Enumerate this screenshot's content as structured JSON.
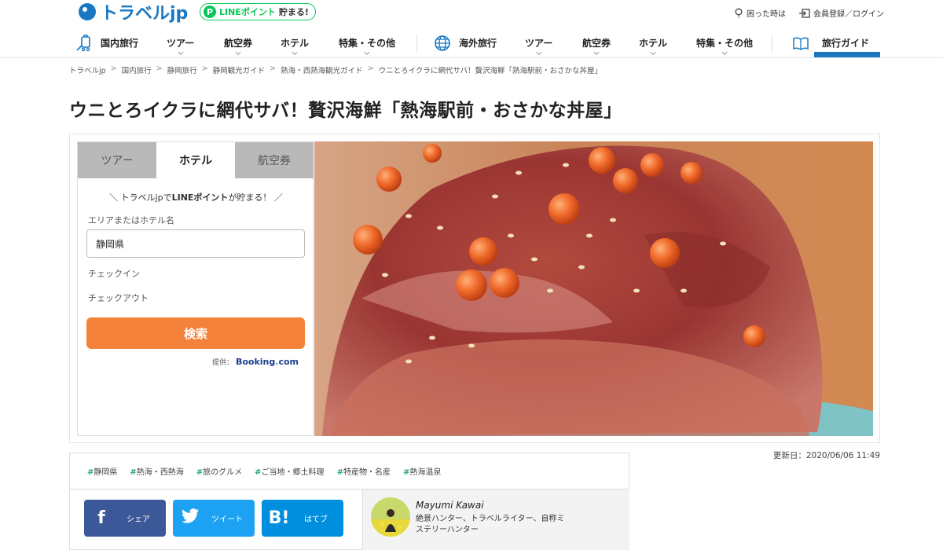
{
  "header": {
    "logo_text": "トラベルjp",
    "line_badge": {
      "prefix": "P",
      "line": "LINEポイント",
      "suffix": "貯まる!"
    },
    "help": "困った時は",
    "login": "会員登録／ログイン"
  },
  "nav": {
    "domestic": [
      "国内旅行",
      "ツアー",
      "航空券",
      "ホテル",
      "特集・その他"
    ],
    "overseas": [
      "海外旅行",
      "ツアー",
      "航空券",
      "ホテル",
      "特集・その他"
    ],
    "guide": "旅行ガイド"
  },
  "breadcrumb": [
    "トラベルjp",
    "国内旅行",
    "静岡旅行",
    "静岡観光ガイド",
    "熱海・西熱海観光ガイド",
    "ウニとろイクラに網代サバ！贅沢海鮮「熱海駅前・おさかな丼屋」"
  ],
  "breadcrumb_separator": ">",
  "article": {
    "title": "ウニとろイクラに網代サバ！贅沢海鮮「熱海駅前・おさかな丼屋」",
    "updated": "更新日：2020/06/06 11:49"
  },
  "search": {
    "tabs": [
      "ツアー",
      "ホテル",
      "航空券"
    ],
    "active_tab": "ホテル",
    "promo_pre": "＼ トラベルjpで",
    "promo_bold": "LINEポイント",
    "promo_post": "が貯まる！ ／",
    "area_label": "エリアまたはホテル名",
    "area_value": "静岡県",
    "checkin_label": "チェックイン",
    "checkout_label": "チェックアウト",
    "button": "検索",
    "provider_prefix": "提供：",
    "provider_name": "Booking",
    "provider_dot": ".",
    "provider_tld": "com"
  },
  "tags": [
    "静岡県",
    "熱海・西熱海",
    "旅のグルメ",
    "ご当地・郷土料理",
    "特産物・名産",
    "熱海温泉"
  ],
  "share": [
    {
      "icon": "f",
      "label": "シェア",
      "color": "#3b5998"
    },
    {
      "icon": "bird",
      "label": "ツイート",
      "color": "#1da1f2"
    },
    {
      "icon": "B!",
      "label": "はてブ",
      "color": "#008fde"
    }
  ],
  "author": {
    "name": "Mayumi Kawai",
    "desc": "絶景ハンター、トラベルライター、自称ミステリーハンター"
  },
  "colors": {
    "brand": "#1a78c2",
    "search_button": "#f5823b",
    "tag_hash": "#2ca58d"
  }
}
